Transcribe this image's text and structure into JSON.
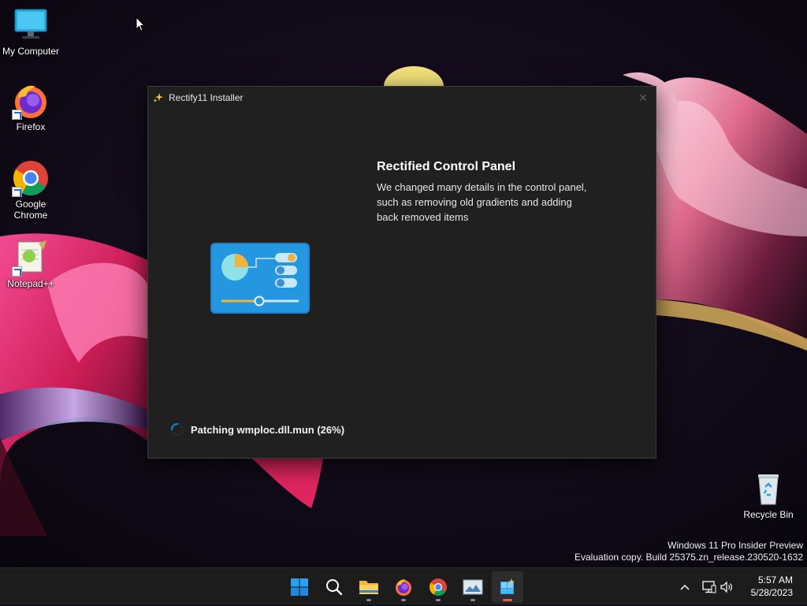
{
  "desktop": {
    "icons": [
      {
        "label": "My Computer",
        "icon": "monitor-icon"
      },
      {
        "label": "Firefox",
        "icon": "firefox-icon"
      },
      {
        "label": "Google Chrome",
        "icon": "chrome-icon"
      },
      {
        "label": "Notepad++",
        "icon": "notepadpp-icon"
      },
      {
        "label": "Recycle Bin",
        "icon": "recycle-bin-icon"
      }
    ]
  },
  "installer": {
    "title": "Rectify11 Installer",
    "heading": "Rectified Control Panel",
    "description": "We changed many details in the control panel, such as removing old gradients and adding back removed items",
    "status": "Patching wmploc.dll.mun (26%)",
    "progress_percent": 26
  },
  "watermark": {
    "line1": "Windows 11 Pro Insider Preview",
    "line2": "Evaluation copy. Build 25375.zn_release.230520-1632"
  },
  "taskbar": {
    "apps": [
      "start-icon",
      "search-icon",
      "file-explorer-icon",
      "firefox-icon",
      "chrome-icon",
      "photos-icon",
      "rectify-installer-icon"
    ],
    "time": "5:57 AM",
    "date": "5/28/2023"
  },
  "colors": {
    "accent": "#0a84d6",
    "window_bg": "#202020",
    "taskbar_bg": "#1c1c1c"
  }
}
